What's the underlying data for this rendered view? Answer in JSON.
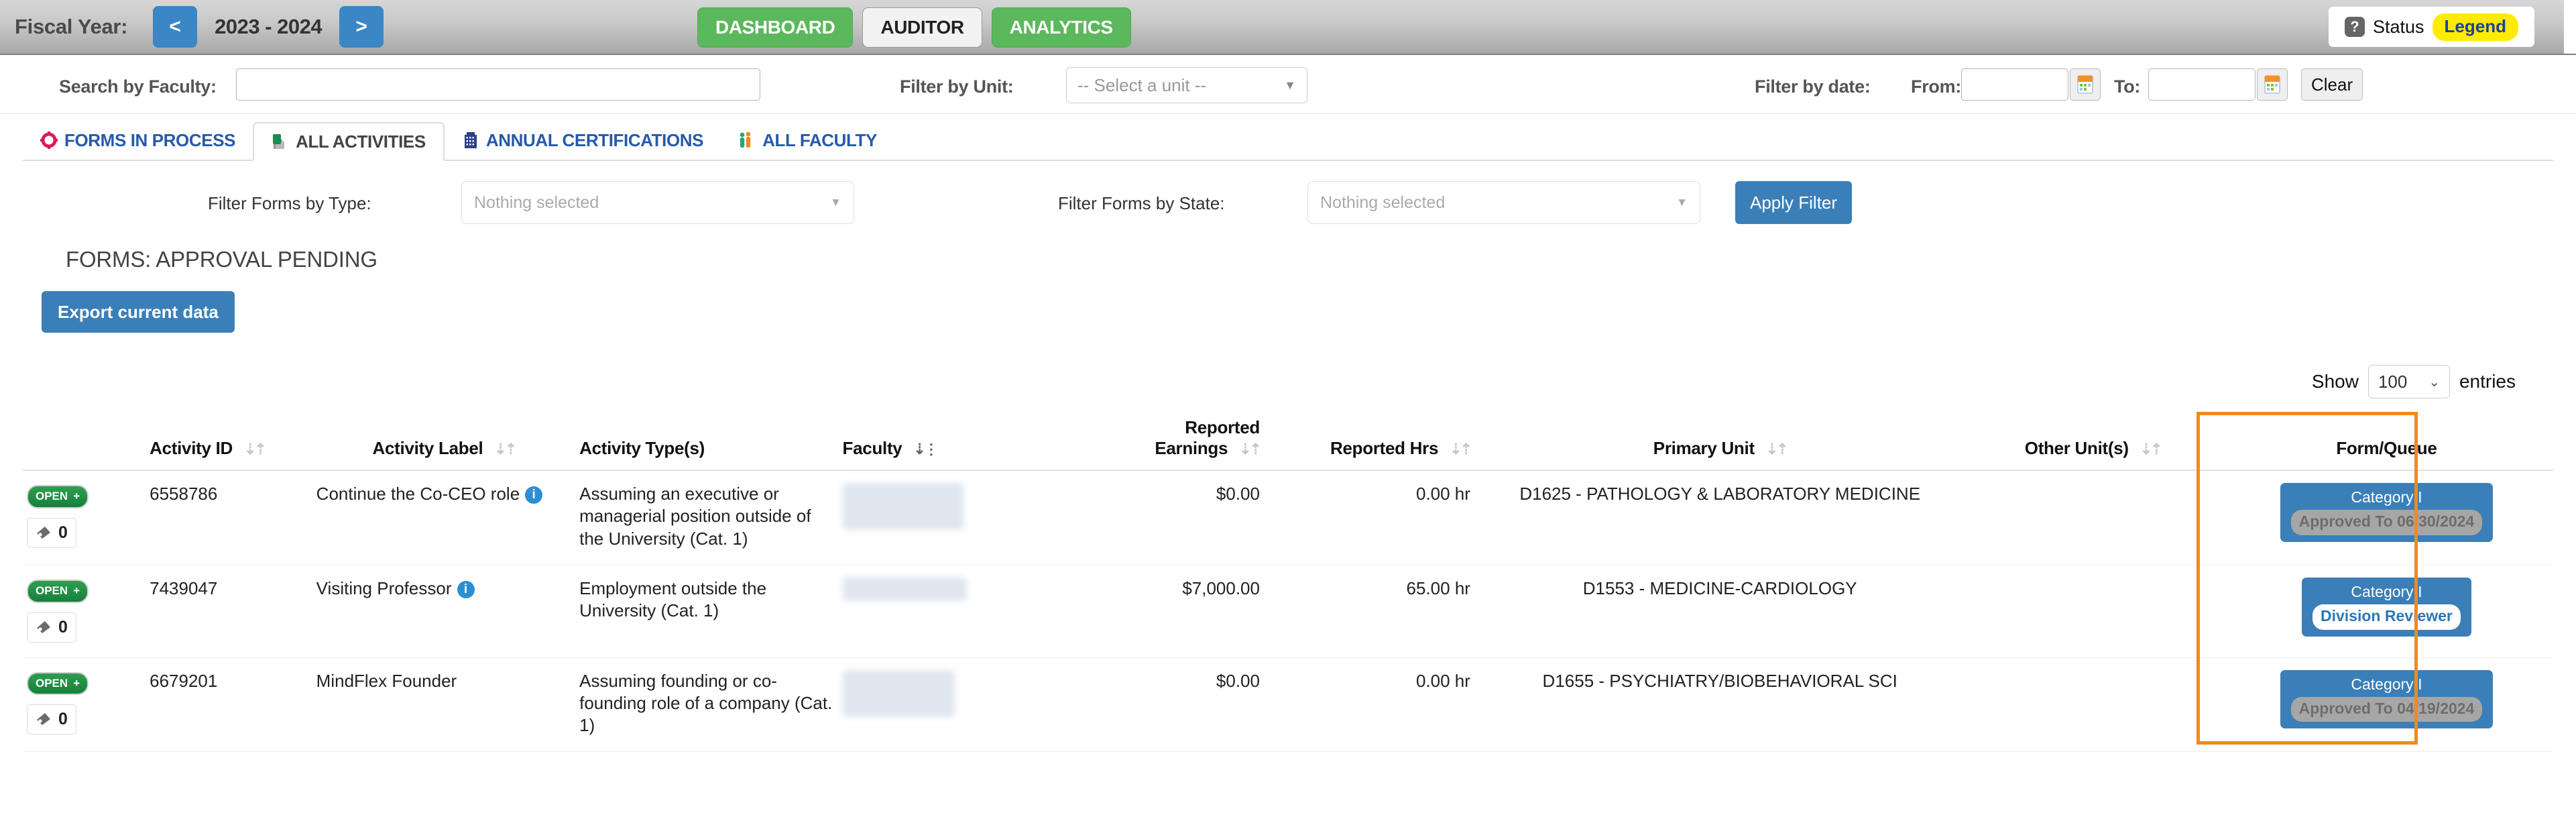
{
  "topbar": {
    "fiscal_year_label": "Fiscal Year:",
    "prev_arrow": "<",
    "next_arrow": ">",
    "fiscal_year_value": "2023 - 2024",
    "nav_buttons": [
      {
        "label": "DASHBOARD",
        "style": "green"
      },
      {
        "label": "AUDITOR",
        "style": "white"
      },
      {
        "label": "ANALYTICS",
        "style": "green"
      }
    ],
    "status": {
      "help_icon": "question-mark-icon",
      "label": "Status",
      "legend_label": "Legend"
    }
  },
  "filters": {
    "search_faculty_label": "Search by Faculty:",
    "search_faculty_value": "",
    "search_faculty_placeholder": "",
    "filter_unit_label": "Filter by Unit:",
    "filter_unit_value": "-- Select a unit --",
    "filter_date_label": "Filter by date:",
    "from_label": "From:",
    "from_value": "",
    "to_label": "To:",
    "to_value": "",
    "clear_label": "Clear",
    "calendar_icon": "calendar-icon"
  },
  "tabs": [
    {
      "label": "FORMS IN PROCESS",
      "icon": "gear-icon",
      "active": false
    },
    {
      "label": "ALL ACTIVITIES",
      "icon": "documents-icon",
      "active": true
    },
    {
      "label": "ANNUAL CERTIFICATIONS",
      "icon": "building-icon",
      "active": false
    },
    {
      "label": "ALL FACULTY",
      "icon": "people-icon",
      "active": false
    }
  ],
  "form_filters": {
    "type_label": "Filter Forms by Type:",
    "type_value": "Nothing selected",
    "state_label": "Filter Forms by State:",
    "state_value": "Nothing selected",
    "apply_label": "Apply Filter"
  },
  "section": {
    "title": "FORMS: APPROVAL PENDING",
    "export_label": "Export current data"
  },
  "table_controls": {
    "show_label": "Show",
    "entries_value": "100",
    "entries_label": "entries"
  },
  "table": {
    "columns": [
      {
        "label": "",
        "sort": "none"
      },
      {
        "label": "Activity ID",
        "sort": "both"
      },
      {
        "label": "Activity Label",
        "sort": "both"
      },
      {
        "label": "Activity Type(s)",
        "sort": "none"
      },
      {
        "label": "Faculty",
        "sort": "active-desc"
      },
      {
        "label": "Reported Earnings",
        "sort": "both"
      },
      {
        "label": "Reported Hrs",
        "sort": "both"
      },
      {
        "label": "Primary Unit",
        "sort": "both"
      },
      {
        "label": "Other Unit(s)",
        "sort": "both"
      },
      {
        "label": "Form/Queue",
        "sort": "none"
      }
    ],
    "header_reported_line1": "Reported",
    "header_reported_line2": "Earnings",
    "rows": [
      {
        "open_label": "OPEN",
        "open_plus": "+",
        "attachment_count": "0",
        "activity_id": "6558786",
        "activity_label": "Continue the Co-CEO role",
        "has_info": true,
        "activity_type": "Assuming an executive or managerial position outside of the University (Cat. 1)",
        "faculty": "",
        "reported_earnings": "$0.00",
        "reported_hrs": "0.00 hr",
        "primary_unit": "D1625 - PATHOLOGY & LABORATORY MEDICINE",
        "other_units": "",
        "form_category": "Category I",
        "form_status": "Approved To 06/30/2024",
        "form_status_style": "grey"
      },
      {
        "open_label": "OPEN",
        "open_plus": "+",
        "attachment_count": "0",
        "activity_id": "7439047",
        "activity_label": "Visiting Professor",
        "has_info": true,
        "activity_type": "Employment outside the University (Cat. 1)",
        "faculty": "",
        "reported_earnings": "$7,000.00",
        "reported_hrs": "65.00 hr",
        "primary_unit": "D1553 - MEDICINE-CARDIOLOGY",
        "other_units": "",
        "form_category": "Category I",
        "form_status": "Division Reviewer",
        "form_status_style": "white"
      },
      {
        "open_label": "OPEN",
        "open_plus": "+",
        "attachment_count": "0",
        "activity_id": "6679201",
        "activity_label": "MindFlex Founder",
        "has_info": false,
        "activity_type": "Assuming founding or co-founding role of a company (Cat. 1)",
        "faculty": "",
        "reported_earnings": "$0.00",
        "reported_hrs": "0.00 hr",
        "primary_unit": "D1655 - PSYCHIATRY/BIOBEHAVIORAL SCI",
        "other_units": "",
        "form_category": "Category I",
        "form_status": "Approved To 04/19/2024",
        "form_status_style": "grey"
      }
    ]
  },
  "colors": {
    "accent_blue": "#3b7fb8",
    "green": "#5cb85c",
    "highlight_orange": "#f08a1c",
    "legend_yellow": "#ffeb00",
    "tab_blue": "#2759a8"
  }
}
